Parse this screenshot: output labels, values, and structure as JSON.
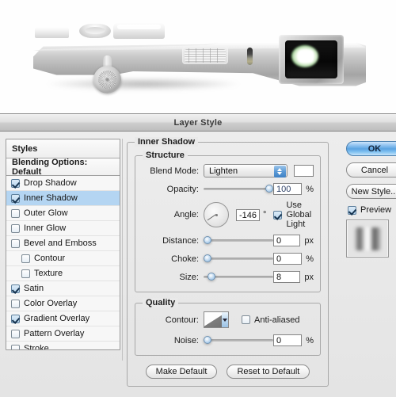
{
  "photo": {
    "alt_description": "silver compact camera body side view with lens",
    "lens_glow_color": "#6fae6a",
    "body_color": "#b4b4b4"
  },
  "dialog": {
    "title": "Layer Style"
  },
  "styles_panel": {
    "header": "Styles",
    "blending_options": "Blending Options: Default",
    "items": [
      {
        "label": "Drop Shadow",
        "checked": true,
        "indent": false,
        "selected": false
      },
      {
        "label": "Inner Shadow",
        "checked": true,
        "indent": false,
        "selected": true
      },
      {
        "label": "Outer Glow",
        "checked": false,
        "indent": false,
        "selected": false
      },
      {
        "label": "Inner Glow",
        "checked": false,
        "indent": false,
        "selected": false
      },
      {
        "label": "Bevel and Emboss",
        "checked": false,
        "indent": false,
        "selected": false
      },
      {
        "label": "Contour",
        "checked": false,
        "indent": true,
        "selected": false
      },
      {
        "label": "Texture",
        "checked": false,
        "indent": true,
        "selected": false
      },
      {
        "label": "Satin",
        "checked": true,
        "indent": false,
        "selected": false
      },
      {
        "label": "Color Overlay",
        "checked": false,
        "indent": false,
        "selected": false
      },
      {
        "label": "Gradient Overlay",
        "checked": true,
        "indent": false,
        "selected": false
      },
      {
        "label": "Pattern Overlay",
        "checked": false,
        "indent": false,
        "selected": false
      },
      {
        "label": "Stroke",
        "checked": false,
        "indent": false,
        "selected": false
      }
    ]
  },
  "inner_shadow": {
    "legend": "Inner Shadow",
    "structure": {
      "legend": "Structure",
      "blend_mode_label": "Blend Mode:",
      "blend_mode_value": "Lighten",
      "color_swatch": "#ffffff",
      "opacity_label": "Opacity:",
      "opacity_value": "100",
      "opacity_unit": "%",
      "opacity_percent": 100,
      "angle_label": "Angle:",
      "angle_value": "-146",
      "angle_unit": "°",
      "angle_degrees": -146,
      "use_global_light_label": "Use Global Light",
      "use_global_light_checked": true,
      "distance_label": "Distance:",
      "distance_value": "0",
      "distance_unit": "px",
      "distance_percent": 0,
      "choke_label": "Choke:",
      "choke_value": "0",
      "choke_unit": "%",
      "choke_percent": 0,
      "size_label": "Size:",
      "size_value": "8",
      "size_unit": "px",
      "size_percent": 6
    },
    "quality": {
      "legend": "Quality",
      "contour_label": "Contour:",
      "anti_aliased_label": "Anti-aliased",
      "anti_aliased_checked": false,
      "noise_label": "Noise:",
      "noise_value": "0",
      "noise_unit": "%",
      "noise_percent": 0
    },
    "buttons": {
      "make_default": "Make Default",
      "reset_to_default": "Reset to Default"
    }
  },
  "actions": {
    "ok": "OK",
    "cancel": "Cancel",
    "new_style": "New Style...",
    "preview_label": "Preview",
    "preview_checked": true
  },
  "colors": {
    "accent": "#5ba3e2",
    "selection": "#b4d5f2",
    "dialog_bg": "#e9e9e9"
  }
}
